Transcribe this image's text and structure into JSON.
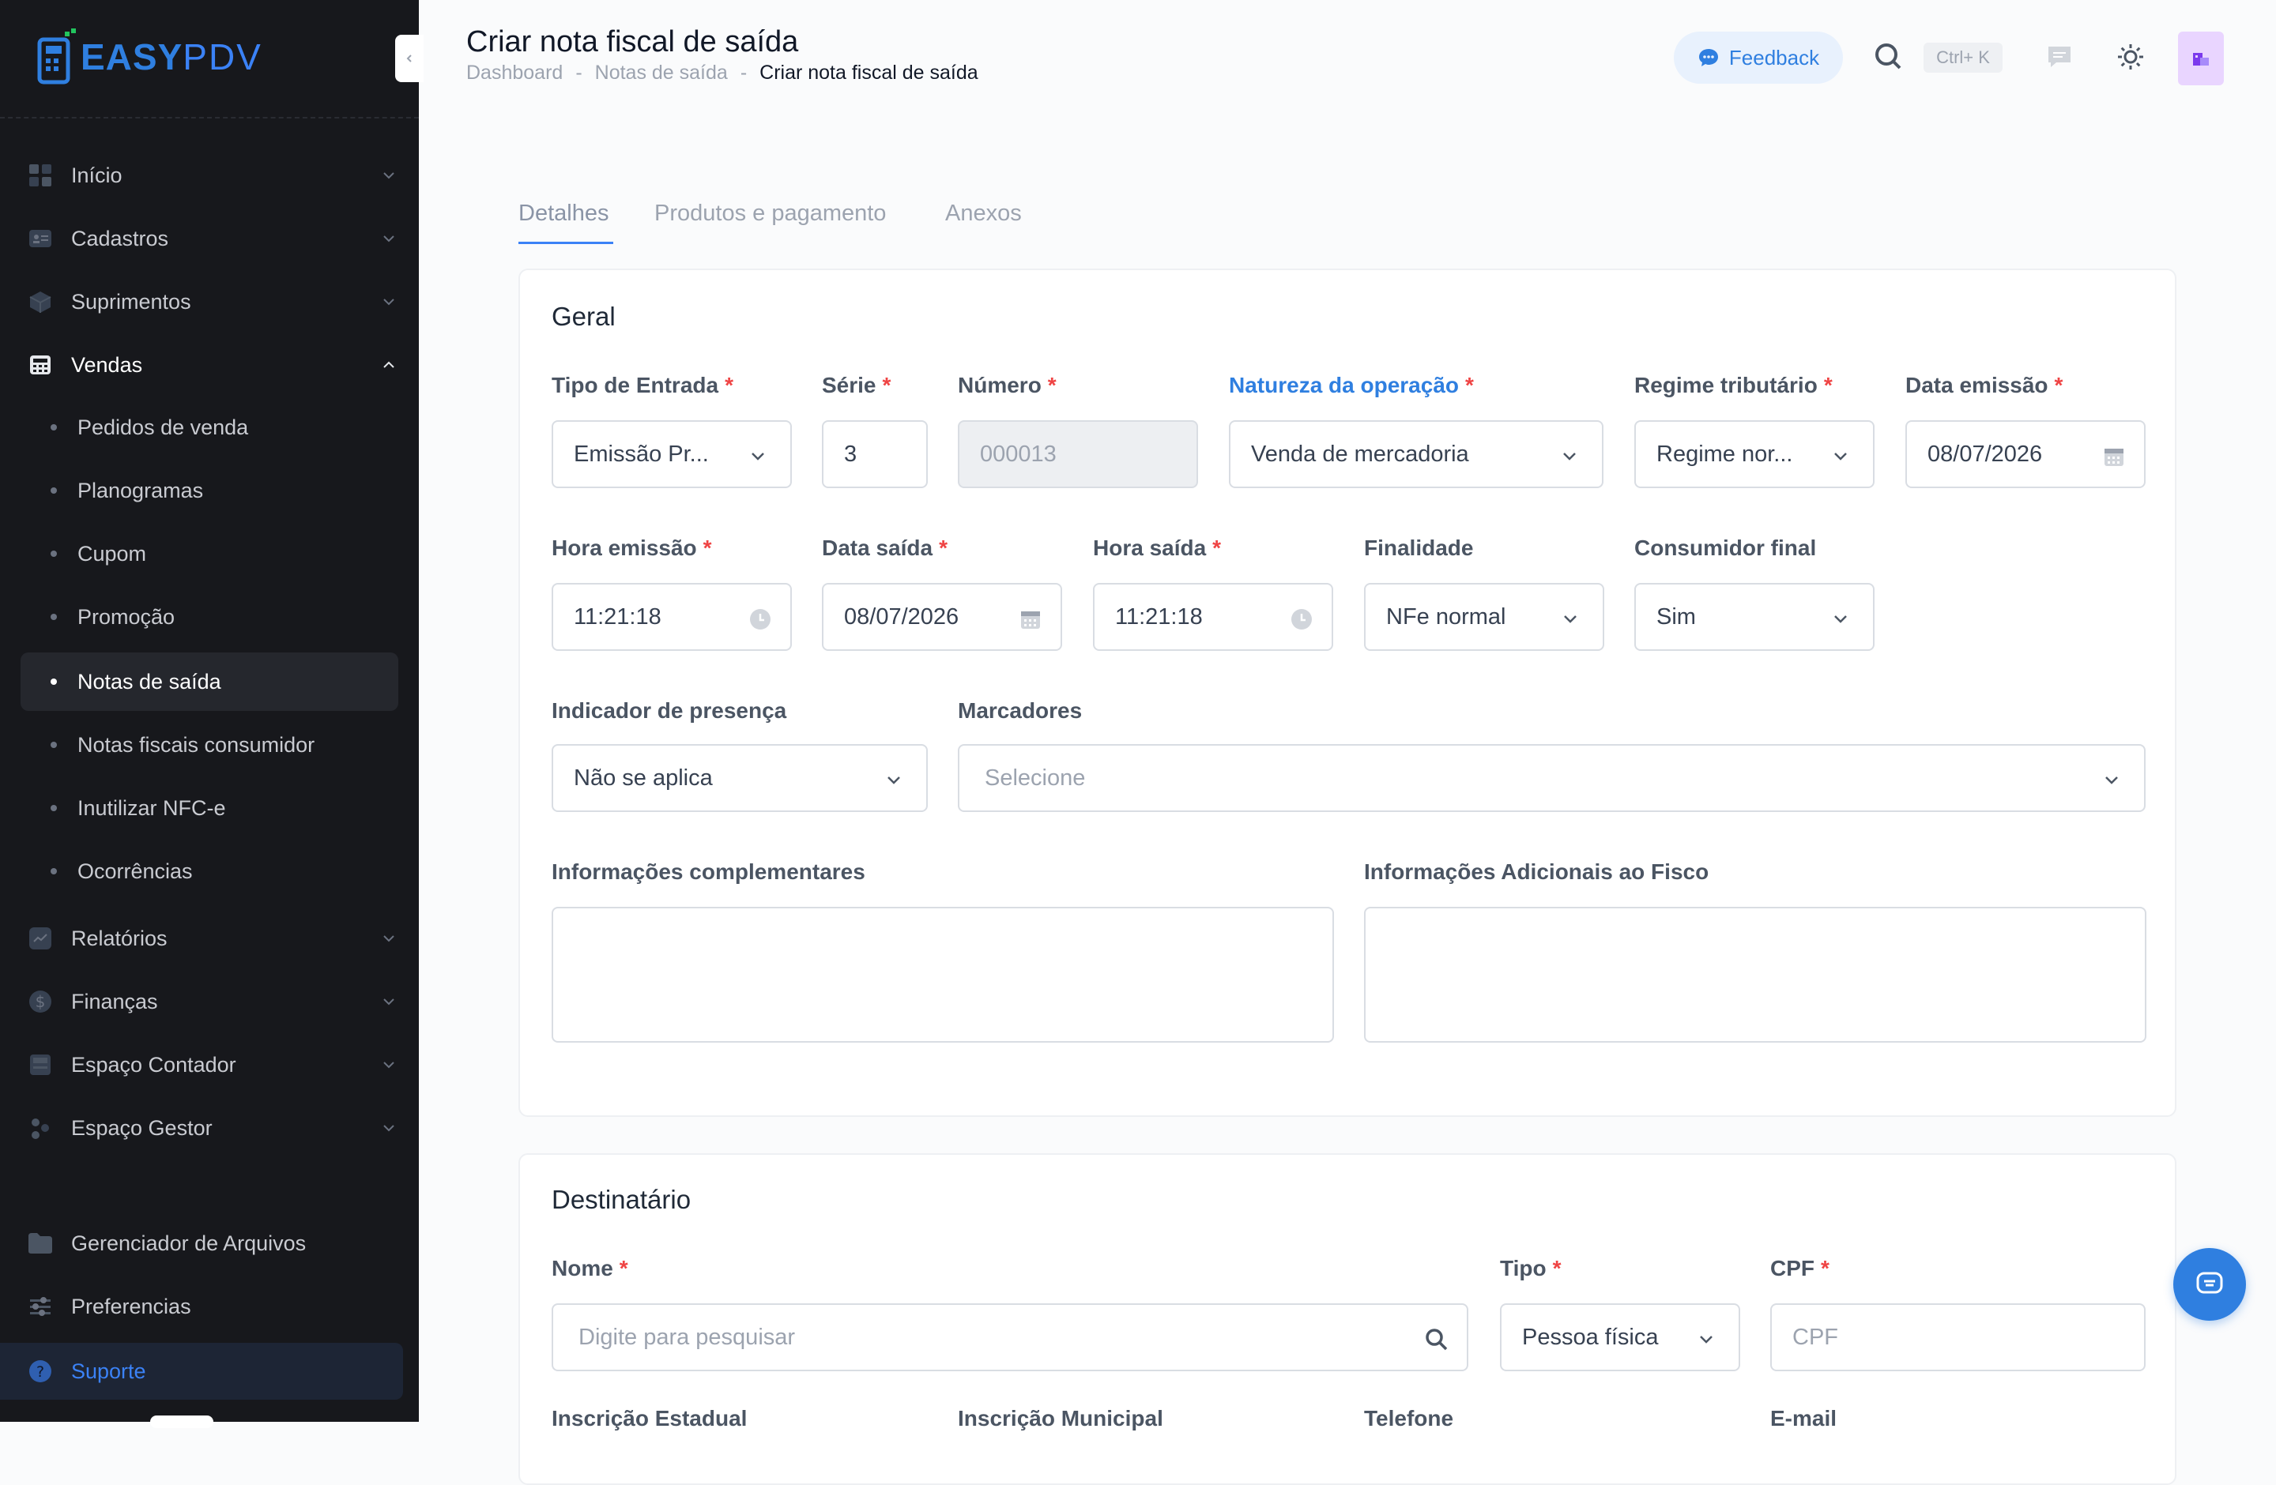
{
  "brand": {
    "easy": "EASY",
    "pdv": "PDV"
  },
  "sidebar": {
    "items": [
      {
        "label": "Início",
        "icon": "grid-icon"
      },
      {
        "label": "Cadastros",
        "icon": "id-card-icon"
      },
      {
        "label": "Suprimentos",
        "icon": "box-icon"
      },
      {
        "label": "Vendas",
        "icon": "register-icon"
      }
    ],
    "vendas_sub": [
      {
        "label": "Pedidos de venda"
      },
      {
        "label": "Planogramas"
      },
      {
        "label": "Cupom"
      },
      {
        "label": "Promoção"
      },
      {
        "label": "Notas de saída"
      },
      {
        "label": "Notas fiscais consumidor"
      },
      {
        "label": "Inutilizar NFC-e"
      },
      {
        "label": "Ocorrências"
      }
    ],
    "items2": [
      {
        "label": "Relatórios",
        "icon": "chart-icon"
      },
      {
        "label": "Finanças",
        "icon": "dollar-icon"
      },
      {
        "label": "Espaço Contador",
        "icon": "calculator-icon"
      },
      {
        "label": "Espaço Gestor",
        "icon": "people-icon"
      }
    ],
    "bottom": [
      {
        "label": "Gerenciador de Arquivos",
        "icon": "folder-icon"
      },
      {
        "label": "Preferencias",
        "icon": "sliders-icon"
      },
      {
        "label": "Suporte",
        "icon": "help-icon"
      }
    ]
  },
  "header": {
    "title": "Criar nota fiscal de saída",
    "breadcrumb": [
      "Dashboard",
      "Notas de saída",
      "Criar nota fiscal de saída"
    ],
    "breadcrumb_sep": "-",
    "feedback": "Feedback",
    "shortcut": "Ctrl+ K"
  },
  "tabs": [
    "Detalhes",
    "Produtos e pagamento",
    "Anexos"
  ],
  "geral": {
    "title": "Geral",
    "tipo_entrada": {
      "label": "Tipo de Entrada",
      "value": "Emissão Pr..."
    },
    "serie": {
      "label": "Série",
      "value": "3"
    },
    "numero": {
      "label": "Número",
      "value": "000013"
    },
    "natureza": {
      "label": "Natureza da operação",
      "value": "Venda de mercadoria"
    },
    "regime": {
      "label": "Regime tributário",
      "value": "Regime nor..."
    },
    "data_emissao": {
      "label": "Data emissão",
      "value": "08/07/2026"
    },
    "hora_emissao": {
      "label": "Hora emissão",
      "value": "11:21:18"
    },
    "data_saida": {
      "label": "Data saída",
      "value": "08/07/2026"
    },
    "hora_saida": {
      "label": "Hora saída",
      "value": "11:21:18"
    },
    "finalidade": {
      "label": "Finalidade",
      "value": "NFe normal"
    },
    "consumidor": {
      "label": "Consumidor final",
      "value": "Sim"
    },
    "presenca": {
      "label": "Indicador de presença",
      "value": "Não se aplica"
    },
    "marcadores": {
      "label": "Marcadores",
      "placeholder": "Selecione"
    },
    "info_comp": {
      "label": "Informações complementares"
    },
    "info_fisco": {
      "label": "Informações Adicionais ao Fisco"
    }
  },
  "destinatario": {
    "title": "Destinatário",
    "nome": {
      "label": "Nome",
      "placeholder": "Digite para pesquisar"
    },
    "tipo": {
      "label": "Tipo",
      "value": "Pessoa física"
    },
    "cpf": {
      "label": "CPF",
      "placeholder": "CPF"
    },
    "ie": {
      "label": "Inscrição Estadual"
    },
    "im": {
      "label": "Inscrição Municipal"
    },
    "telefone": {
      "label": "Telefone"
    },
    "email": {
      "label": "E-mail"
    }
  },
  "required_mark": "*",
  "colors": {
    "sidebar_bg": "#17181c",
    "accent": "#2f7fe0",
    "required": "#ef4444"
  }
}
